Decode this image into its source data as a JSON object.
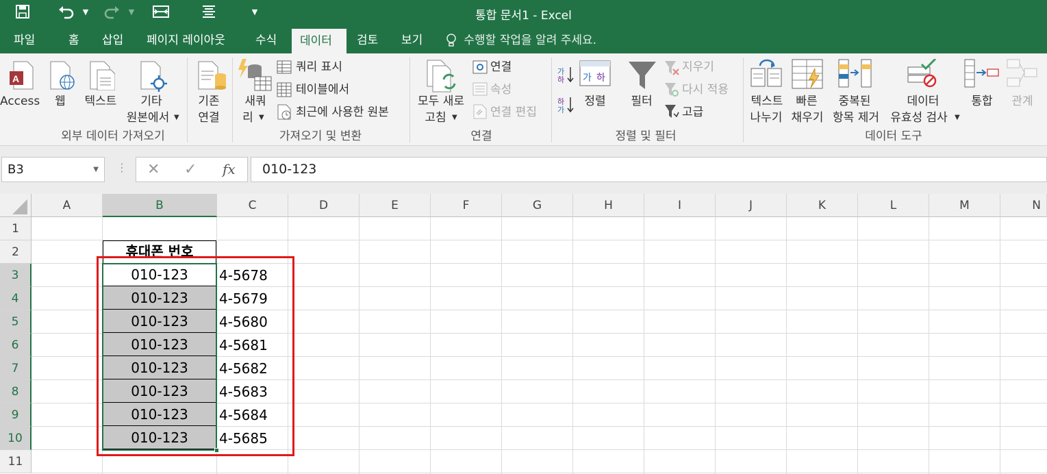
{
  "title": "통합 문서1 - Excel",
  "menu": [
    "파일",
    "홈",
    "삽입",
    "페이지 레이아웃",
    "수식",
    "데이터",
    "검토",
    "보기"
  ],
  "tell_me": "수행할 작업을 알려 주세요.",
  "ribbon": {
    "access": "Access",
    "web": "웹",
    "text": "텍스트",
    "other1": "기타",
    "other2": "원본에서",
    "existing1": "기존",
    "existing2": "연결",
    "newquery1": "새쿼",
    "newquery2": "리",
    "show_query": "쿼리 표시",
    "from_table": "테이블에서",
    "recent": "최근에 사용한 원본",
    "refresh1": "모두 새로",
    "refresh2": "고침",
    "connections": "연결",
    "properties": "속성",
    "edit_links": "연결 편집",
    "sort": "정렬",
    "filter": "필터",
    "clear": "지우기",
    "reapply": "다시 적용",
    "advanced": "고급",
    "text_to_col1": "텍스트",
    "text_to_col2": "나누기",
    "flash1": "빠른",
    "flash2": "채우기",
    "dup1": "중복된",
    "dup2": "항목 제거",
    "valid1": "데이터",
    "valid2": "유효성 검사",
    "consolidate": "통합",
    "relations": "관계",
    "groups": [
      "외부 데이터 가져오기",
      "가져오기 및 변환",
      "연결",
      "정렬 및 필터",
      "데이터 도구"
    ]
  },
  "name_box": "B3",
  "formula": "010-123",
  "columns": [
    "A",
    "B",
    "C",
    "D",
    "E",
    "F",
    "G",
    "H",
    "I",
    "J",
    "K",
    "L",
    "M",
    "N"
  ],
  "rows": [
    "1",
    "2",
    "3",
    "4",
    "5",
    "6",
    "7",
    "8",
    "9",
    "10",
    "11"
  ],
  "header_cell": "휴대폰 번호",
  "b_values": [
    "010-123",
    "010-123",
    "010-123",
    "010-123",
    "010-123",
    "010-123",
    "010-123",
    "010-123"
  ],
  "c_values": [
    "4-5678",
    "4-5679",
    "4-5680",
    "4-5681",
    "4-5682",
    "4-5683",
    "4-5684",
    "4-5685"
  ],
  "colors": {
    "excel_green": "#217346",
    "highlight_red": "#e01a1a",
    "selection_gray": "#c8c8c8"
  }
}
